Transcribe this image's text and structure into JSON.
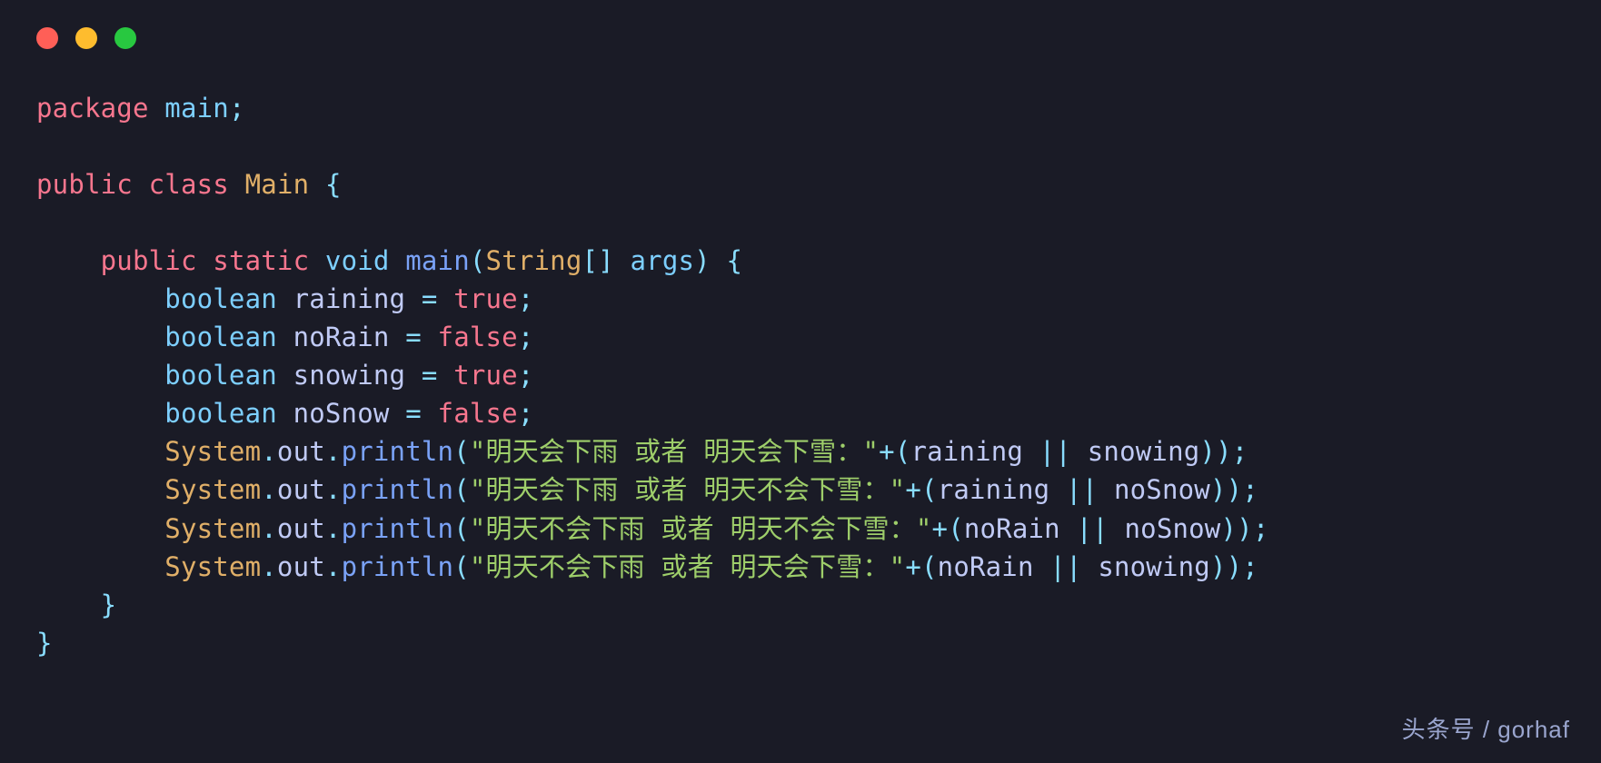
{
  "window": {
    "controls": [
      "close",
      "minimize",
      "zoom"
    ]
  },
  "footer": "头条号 / gorhaf",
  "code": {
    "packageKw": "package",
    "packageName": "main",
    "publicKw": "public",
    "classKw": "class",
    "className": "Main",
    "staticKw": "static",
    "voidKw": "void",
    "mainFn": "main",
    "stringType": "String",
    "brackets": "[]",
    "argsName": "args",
    "booleanKw": "boolean",
    "var1": "raining",
    "var2": "noRain",
    "var3": "snowing",
    "var4": "noSnow",
    "trueKw": "true",
    "falseKw": "false",
    "eq": " = ",
    "semi": ";",
    "lbrace": "{",
    "rbrace": "}",
    "lparen": "(",
    "rparen": ")",
    "sys": "System",
    "dot": ".",
    "out": "out",
    "println": "println",
    "plus": "+",
    "or": "||",
    "str1": "\"明天会下雨 或者 明天会下雪：\"",
    "str2": "\"明天会下雨 或者 明天不会下雪：\"",
    "str3": "\"明天不会下雨 或者 明天不会下雪：\"",
    "str4": "\"明天不会下雨 或者 明天会下雪：\"",
    "call1Args": [
      "raining",
      "snowing"
    ],
    "call2Args": [
      "raining",
      "noSnow"
    ],
    "call3Args": [
      "noRain",
      "noSnow"
    ],
    "call4Args": [
      "noRain",
      "snowing"
    ]
  }
}
